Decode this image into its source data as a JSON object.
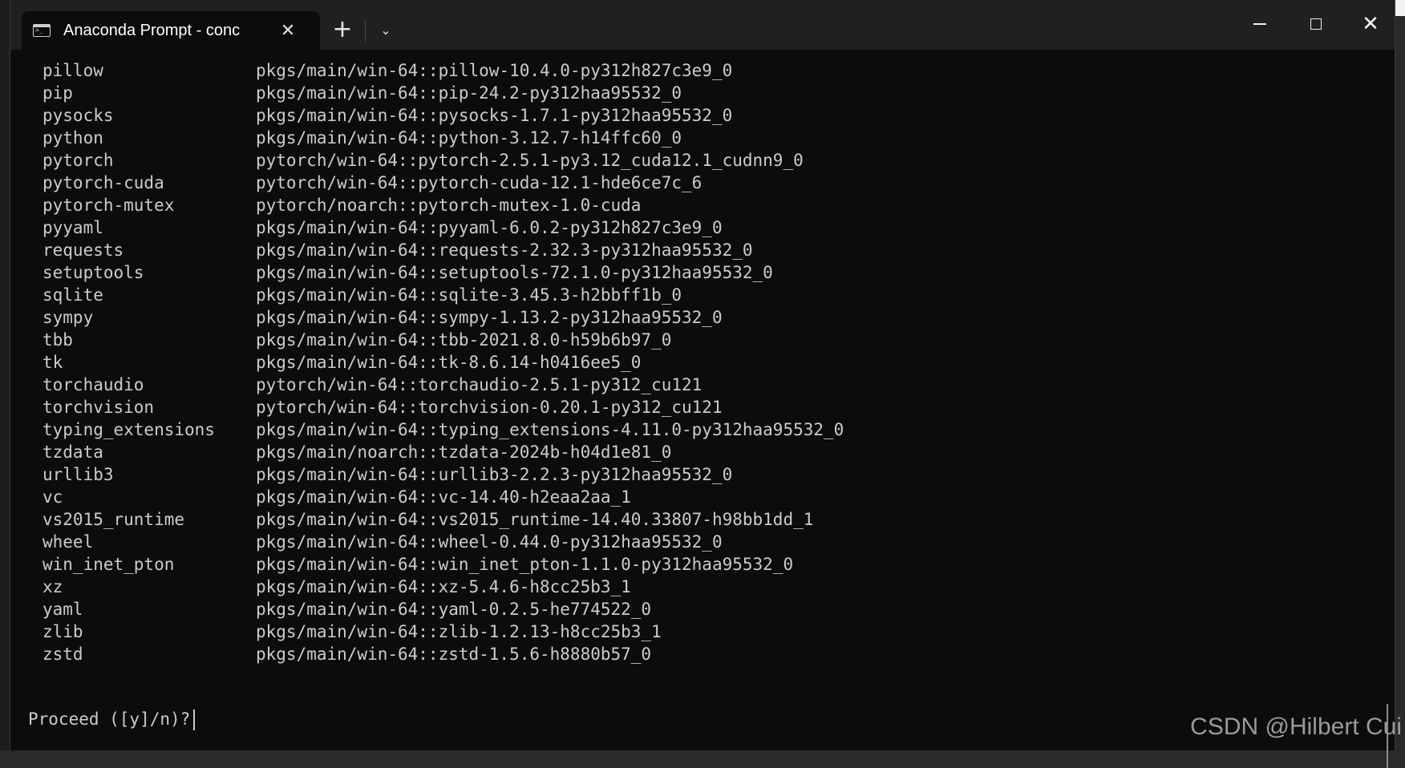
{
  "window": {
    "tab_title": "Anaconda Prompt - conc",
    "close_tab_glyph": "✕",
    "new_tab_glyph": "+",
    "dropdown_glyph": "⌄",
    "close_window_glyph": "✕"
  },
  "packages": [
    {
      "name": "pillow",
      "source": "pkgs/main/win-64::pillow-10.4.0-py312h827c3e9_0"
    },
    {
      "name": "pip",
      "source": "pkgs/main/win-64::pip-24.2-py312haa95532_0"
    },
    {
      "name": "pysocks",
      "source": "pkgs/main/win-64::pysocks-1.7.1-py312haa95532_0"
    },
    {
      "name": "python",
      "source": "pkgs/main/win-64::python-3.12.7-h14ffc60_0"
    },
    {
      "name": "pytorch",
      "source": "pytorch/win-64::pytorch-2.5.1-py3.12_cuda12.1_cudnn9_0"
    },
    {
      "name": "pytorch-cuda",
      "source": "pytorch/win-64::pytorch-cuda-12.1-hde6ce7c_6"
    },
    {
      "name": "pytorch-mutex",
      "source": "pytorch/noarch::pytorch-mutex-1.0-cuda"
    },
    {
      "name": "pyyaml",
      "source": "pkgs/main/win-64::pyyaml-6.0.2-py312h827c3e9_0"
    },
    {
      "name": "requests",
      "source": "pkgs/main/win-64::requests-2.32.3-py312haa95532_0"
    },
    {
      "name": "setuptools",
      "source": "pkgs/main/win-64::setuptools-72.1.0-py312haa95532_0"
    },
    {
      "name": "sqlite",
      "source": "pkgs/main/win-64::sqlite-3.45.3-h2bbff1b_0"
    },
    {
      "name": "sympy",
      "source": "pkgs/main/win-64::sympy-1.13.2-py312haa95532_0"
    },
    {
      "name": "tbb",
      "source": "pkgs/main/win-64::tbb-2021.8.0-h59b6b97_0"
    },
    {
      "name": "tk",
      "source": "pkgs/main/win-64::tk-8.6.14-h0416ee5_0"
    },
    {
      "name": "torchaudio",
      "source": "pytorch/win-64::torchaudio-2.5.1-py312_cu121"
    },
    {
      "name": "torchvision",
      "source": "pytorch/win-64::torchvision-0.20.1-py312_cu121"
    },
    {
      "name": "typing_extensions",
      "source": "pkgs/main/win-64::typing_extensions-4.11.0-py312haa95532_0"
    },
    {
      "name": "tzdata",
      "source": "pkgs/main/noarch::tzdata-2024b-h04d1e81_0"
    },
    {
      "name": "urllib3",
      "source": "pkgs/main/win-64::urllib3-2.2.3-py312haa95532_0"
    },
    {
      "name": "vc",
      "source": "pkgs/main/win-64::vc-14.40-h2eaa2aa_1"
    },
    {
      "name": "vs2015_runtime",
      "source": "pkgs/main/win-64::vs2015_runtime-14.40.33807-h98bb1dd_1"
    },
    {
      "name": "wheel",
      "source": "pkgs/main/win-64::wheel-0.44.0-py312haa95532_0"
    },
    {
      "name": "win_inet_pton",
      "source": "pkgs/main/win-64::win_inet_pton-1.1.0-py312haa95532_0"
    },
    {
      "name": "xz",
      "source": "pkgs/main/win-64::xz-5.4.6-h8cc25b3_1"
    },
    {
      "name": "yaml",
      "source": "pkgs/main/win-64::yaml-0.2.5-he774522_0"
    },
    {
      "name": "zlib",
      "source": "pkgs/main/win-64::zlib-1.2.13-h8cc25b3_1"
    },
    {
      "name": "zstd",
      "source": "pkgs/main/win-64::zstd-1.5.6-h8880b57_0"
    }
  ],
  "prompt": "Proceed ([y]/n)?",
  "watermark": "CSDN @Hilbert Cui",
  "colors": {
    "terminal_bg": "#0c0c0c",
    "terminal_text": "#cccccc",
    "titlebar_bg": "#202020"
  }
}
